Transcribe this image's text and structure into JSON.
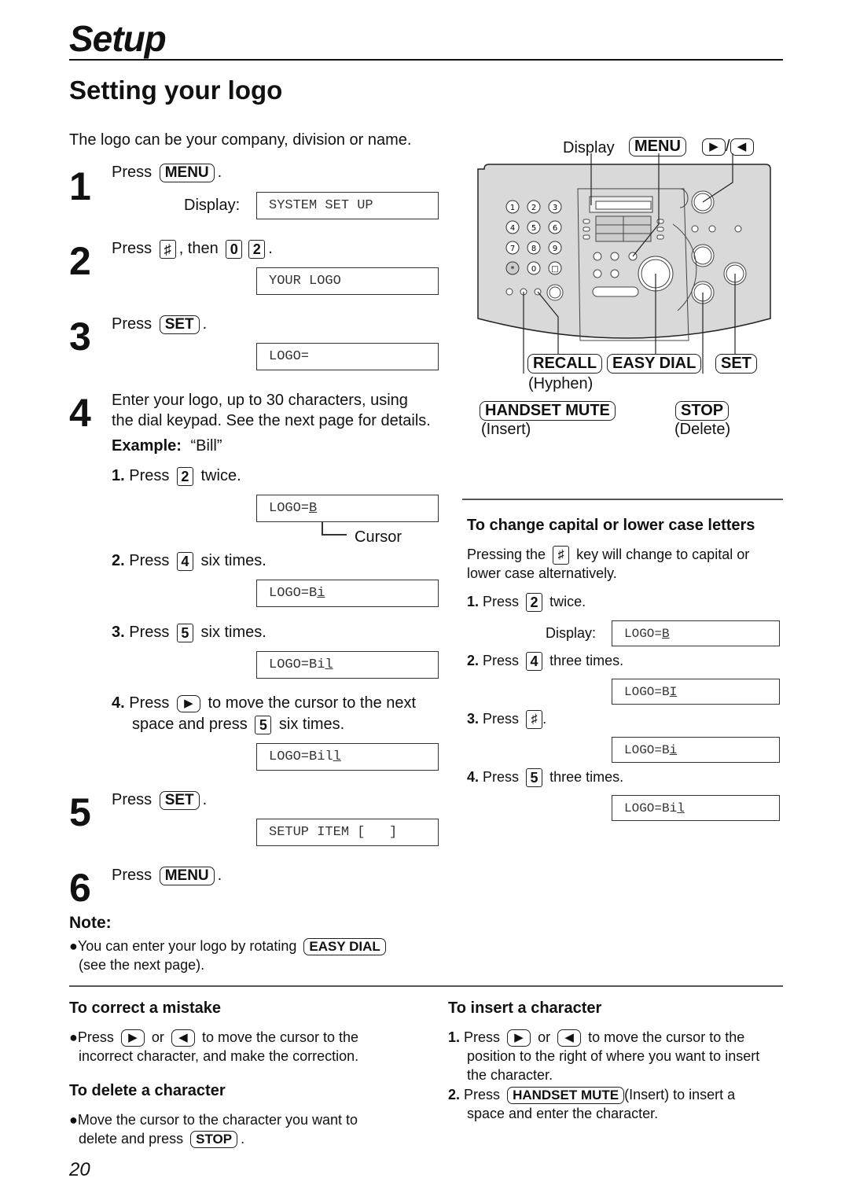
{
  "header": {
    "section": "Setup",
    "title": "Setting your logo",
    "intro": "The logo can be your company, division or name."
  },
  "steps": {
    "s1": {
      "num": "1",
      "press": "Press",
      "key": "MENU",
      "display_label": "Display:",
      "lcd": "SYSTEM SET UP"
    },
    "s2": {
      "num": "2",
      "press": "Press",
      "key_hash": "♯",
      "then": ", then",
      "key_0": "0",
      "key_2": "2",
      "lcd": "YOUR LOGO"
    },
    "s3": {
      "num": "3",
      "press": "Press",
      "key": "SET",
      "lcd": "LOGO="
    },
    "s4": {
      "num": "4",
      "text_line1": "Enter your logo, up to 30 characters, using",
      "text_line2": "the dial keypad. See the next page for details.",
      "example_label": "Example:",
      "example_value": "“Bill”",
      "substeps": [
        {
          "n": "1.",
          "press": "Press",
          "key": "2",
          "after": "twice.",
          "lcd_prefix": "LOGO=",
          "lcd_cursor": "B",
          "cursor_label": "Cursor"
        },
        {
          "n": "2.",
          "press": "Press",
          "key": "4",
          "after": "six times.",
          "lcd_prefix": "LOGO=B",
          "lcd_cursor": "i"
        },
        {
          "n": "3.",
          "press": "Press",
          "key": "5",
          "after": "six times.",
          "lcd_prefix": "LOGO=Bi",
          "lcd_cursor": "l"
        },
        {
          "n": "4.",
          "press": "Press",
          "key": "▶",
          "after": "to move the cursor to the next",
          "line2_pre": "space and press",
          "key2": "5",
          "line2_post": "six times.",
          "lcd_prefix": "LOGO=Bil",
          "lcd_cursor": "l"
        }
      ]
    },
    "s5": {
      "num": "5",
      "press": "Press",
      "key": "SET",
      "lcd": "SETUP ITEM [   ]"
    },
    "s6": {
      "num": "6",
      "press": "Press",
      "key": "MENU"
    }
  },
  "note": {
    "title": "Note:",
    "text_pre": "You can enter your logo by rotating",
    "key": "EASY DIAL",
    "text_post": "(see the next page)."
  },
  "diagram": {
    "display_label": "Display",
    "menu_key": "MENU",
    "right_key": "▶",
    "left_key": "◀",
    "slash": "/",
    "keypad": [
      "1",
      "2",
      "3",
      "4",
      "5",
      "6",
      "7",
      "8",
      "9",
      "*",
      "0",
      "□"
    ],
    "recall": "RECALL",
    "recall_sub": "(Hyphen)",
    "easy_dial": "EASY DIAL",
    "set": "SET",
    "handset_mute": "HANDSET MUTE",
    "handset_mute_sub": "(Insert)",
    "stop": "STOP",
    "stop_sub": "(Delete)"
  },
  "case_section": {
    "title": "To change capital or lower case letters",
    "text_pre": "Pressing the",
    "key": "♯",
    "text_post": "key will change to capital or",
    "text_line2": "lower case alternatively.",
    "display_label": "Display:",
    "steps": [
      {
        "n": "1.",
        "press": "Press",
        "key": "2",
        "after": "twice.",
        "lcd_prefix": "LOGO=",
        "lcd_cursor": "B"
      },
      {
        "n": "2.",
        "press": "Press",
        "key": "4",
        "after": "three times.",
        "lcd_prefix": "LOGO=B",
        "lcd_cursor": "I"
      },
      {
        "n": "3.",
        "press": "Press",
        "key": "♯",
        "after": ".",
        "lcd_prefix": "LOGO=B",
        "lcd_cursor": "i"
      },
      {
        "n": "4.",
        "press": "Press",
        "key": "5",
        "after": "three times.",
        "lcd_prefix": "LOGO=Bi",
        "lcd_cursor": "l"
      }
    ]
  },
  "correct": {
    "title": "To correct a mistake",
    "pre": "Press",
    "key_right": "▶",
    "or": "or",
    "key_left": "◀",
    "post": "to move the cursor to the",
    "line2": "incorrect character, and make the correction."
  },
  "delete": {
    "title": "To delete a character",
    "line1": "Move the cursor to the character you want to",
    "line2_pre": "delete and press",
    "key": "STOP",
    "line2_post": "."
  },
  "insert": {
    "title": "To insert a character",
    "s1_n": "1.",
    "s1_pre": "Press",
    "key_right": "▶",
    "or": "or",
    "key_left": "◀",
    "s1_post": "to move the cursor to the",
    "s1_line2": "position to the right of where you want to insert",
    "s1_line3": "the character.",
    "s2_n": "2.",
    "s2_pre": "Press",
    "s2_key": "HANDSET MUTE",
    "s2_post": "(Insert) to insert a",
    "s2_line2": "space and enter the character."
  },
  "page_number": "20"
}
